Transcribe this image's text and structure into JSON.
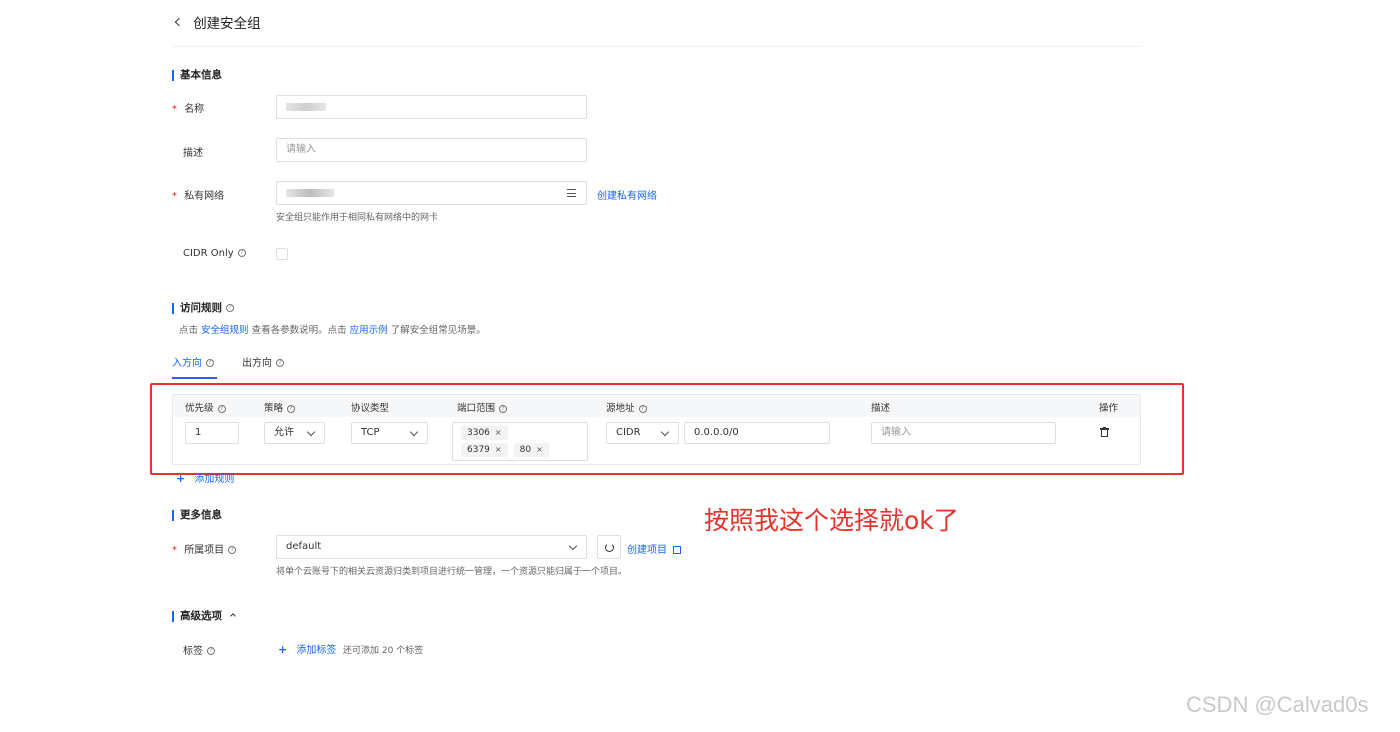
{
  "header": {
    "title": "创建安全组"
  },
  "basic": {
    "section_title": "基本信息",
    "name_label": "名称",
    "desc_label": "描述",
    "desc_placeholder": "请输入",
    "vpc_label": "私有网络",
    "vpc_link": "创建私有网络",
    "vpc_hint": "安全组只能作用于相同私有网络中的网卡",
    "cidr_label": "CIDR Only"
  },
  "rules": {
    "section_title": "访问规则",
    "desc_prefix": "点击",
    "desc_link1": "安全组规则",
    "desc_middle": "查看各参数说明。点击",
    "desc_link2": "应用示例",
    "desc_suffix": "了解安全组常见场景。",
    "tabs": [
      "入方向",
      "出方向"
    ],
    "columns": [
      "优先级",
      "策略",
      "协议类型",
      "端口范围",
      "源地址",
      "描述",
      "操作"
    ],
    "row": {
      "priority": "1",
      "policy": "允许",
      "protocol": "TCP",
      "ports": [
        "3306",
        "6379",
        "80"
      ],
      "source_type": "CIDR",
      "source_value": "0.0.0.0/0",
      "desc_placeholder": "请输入"
    },
    "add_rule": "添加规则"
  },
  "annotation": {
    "text": "按照我这个选择就ok了",
    "color": "#e8322d"
  },
  "more": {
    "section_title": "更多信息",
    "project_label": "所属项目",
    "project_value": "default",
    "create_project_link": "创建项目",
    "project_hint": "将单个云账号下的相关云资源归类到项目进行统一管理，一个资源只能归属于一个项目。"
  },
  "advanced": {
    "section_title": "高级选项",
    "tag_label": "标签",
    "add_tag": "添加标签",
    "tag_hint": "还可添加 20 个标签"
  },
  "watermark": "CSDN @Calvad0s",
  "colors": {
    "accent": "#1764ff",
    "required": "#e02020",
    "highlight_box": "#e8322d"
  }
}
